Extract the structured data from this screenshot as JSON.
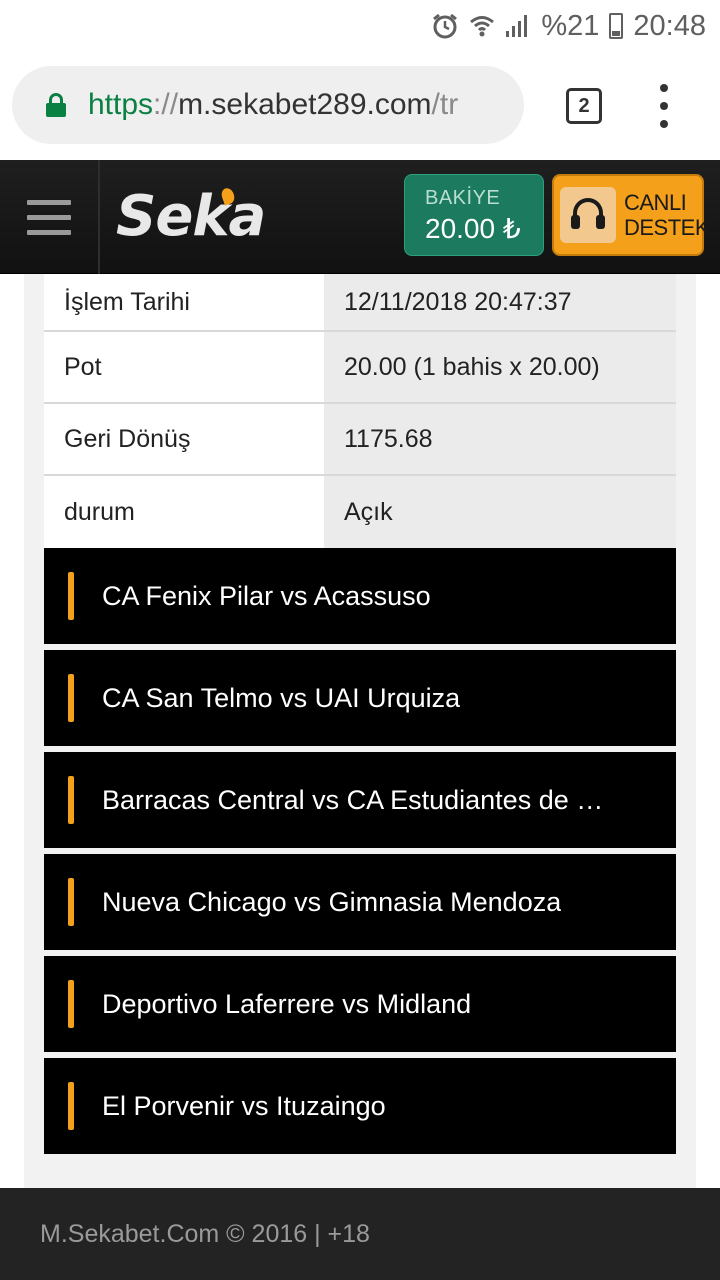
{
  "status_bar": {
    "alarm_icon": "alarm-clock-icon",
    "wifi_icon": "wifi-icon",
    "signal_icon": "signal-icon",
    "battery_text": "%21",
    "time": "20:48"
  },
  "browser": {
    "url_scheme": "https",
    "url_separator": "://",
    "url_host": "m.sekabet289.com",
    "url_rest": "/tr",
    "tab_count": "2"
  },
  "header": {
    "logo_text": "Seka",
    "balance_label": "BAKİYE",
    "balance_value": "20.00 ₺",
    "support_line1": "CANLI",
    "support_line2": "DESTEK"
  },
  "bet_details": [
    {
      "key": "İşlem Tarihi",
      "value": "12/11/2018 20:47:37"
    },
    {
      "key": "Pot",
      "value": "20.00 (1 bahis x 20.00)"
    },
    {
      "key": "Geri Dönüş",
      "value": "1175.68"
    },
    {
      "key": "durum",
      "value": "Açık"
    }
  ],
  "matches": [
    "CA Fenix Pilar vs Acassuso",
    "CA San Telmo vs UAI Urquiza",
    "Barracas Central vs CA Estudiantes de …",
    "Nueva Chicago vs Gimnasia Mendoza",
    "Deportivo Laferrere vs Midland",
    "El Porvenir vs Ituzaingo"
  ],
  "footer": {
    "text": "M.Sekabet.Com © 2016 | +18"
  },
  "colors": {
    "accent_orange": "#f5a01a",
    "balance_green": "#1c7a5e",
    "secure_green": "#0b8043"
  }
}
